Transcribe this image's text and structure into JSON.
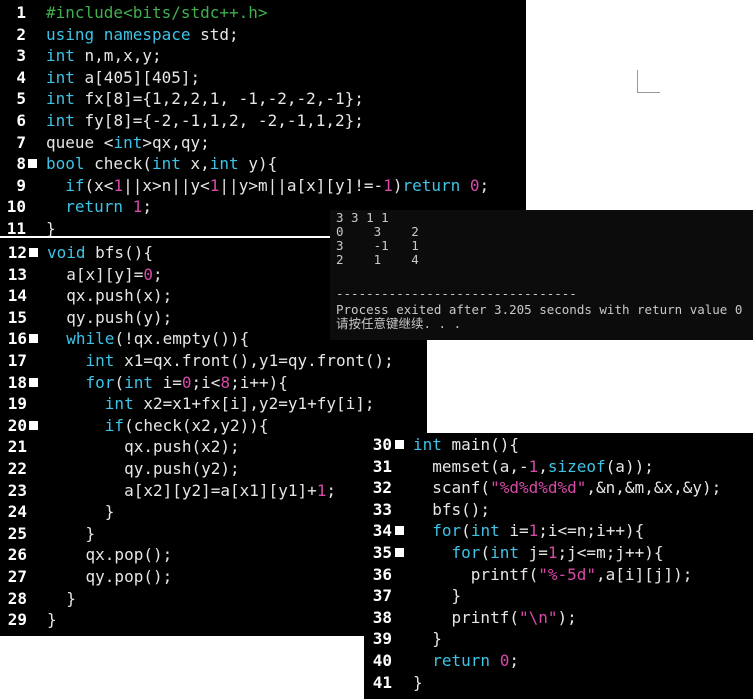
{
  "panel1": {
    "lines": [
      {
        "num": "1",
        "fold": false,
        "html": "<span class=\"pp\">#include&lt;bits/stdc++.h&gt;</span>"
      },
      {
        "num": "2",
        "fold": false,
        "html": "<span class=\"kw\">using namespace</span><span class=\"tx\"> std;</span>"
      },
      {
        "num": "3",
        "fold": false,
        "html": "<span class=\"kw\">int</span><span class=\"tx\"> n,m,x,y;</span>"
      },
      {
        "num": "4",
        "fold": false,
        "html": "<span class=\"kw\">int</span><span class=\"tx\"> a[405][405];</span>"
      },
      {
        "num": "5",
        "fold": false,
        "html": "<span class=\"kw\">int</span><span class=\"tx\"> fx[8]={1,2,2,1, -1,-2,-2,-1};</span>"
      },
      {
        "num": "6",
        "fold": false,
        "html": "<span class=\"kw\">int</span><span class=\"tx\"> fy[8]={-2,-1,1,2, -2,-1,1,2};</span>"
      },
      {
        "num": "7",
        "fold": false,
        "html": "<span class=\"tx\">queue &lt;</span><span class=\"kw\">int</span><span class=\"tx\">&gt;qx,qy;</span>"
      },
      {
        "num": "8",
        "fold": true,
        "html": "<span class=\"kw\">bool</span><span class=\"tx\"> check(</span><span class=\"kw\">int</span><span class=\"tx\"> x,</span><span class=\"kw\">int</span><span class=\"tx\"> y){</span>"
      },
      {
        "num": "9",
        "fold": false,
        "html": "<span class=\"tx\">  </span><span class=\"kw\">if</span><span class=\"tx\">(x&lt;</span><span class=\"nm\">1</span><span class=\"tx\">||x&gt;n||y&lt;</span><span class=\"nm\">1</span><span class=\"tx\">||y&gt;m||a[x][y]!=-</span><span class=\"nm\">1</span><span class=\"tx\">)</span><span class=\"kw\">return</span><span class=\"tx\"> </span><span class=\"nm\">0</span><span class=\"tx\">;</span>"
      },
      {
        "num": "10",
        "fold": false,
        "html": "<span class=\"tx\">  </span><span class=\"kw\">return</span><span class=\"tx\"> </span><span class=\"nm\">1</span><span class=\"tx\">;</span>"
      },
      {
        "num": "11",
        "fold": false,
        "html": "<span class=\"tx\">}</span>"
      }
    ]
  },
  "panel2": {
    "lines": [
      {
        "num": "12",
        "fold": true,
        "html": "<span class=\"kw\">void</span><span class=\"tx\"> bfs(){</span>"
      },
      {
        "num": "13",
        "fold": false,
        "html": "<span class=\"tx\">  a[x][y]=</span><span class=\"nm\">0</span><span class=\"tx\">;</span>"
      },
      {
        "num": "14",
        "fold": false,
        "html": "<span class=\"tx\">  qx.push(x);</span>"
      },
      {
        "num": "15",
        "fold": false,
        "html": "<span class=\"tx\">  qy.push(y);</span>"
      },
      {
        "num": "16",
        "fold": true,
        "html": "<span class=\"tx\">  </span><span class=\"kw\">while</span><span class=\"tx\">(!qx.empty()){</span>"
      },
      {
        "num": "17",
        "fold": false,
        "html": "<span class=\"tx\">    </span><span class=\"kw\">int</span><span class=\"tx\"> x1=qx.front(),y1=qy.front();</span>"
      },
      {
        "num": "18",
        "fold": true,
        "html": "<span class=\"tx\">    </span><span class=\"kw\">for</span><span class=\"tx\">(</span><span class=\"kw\">int</span><span class=\"tx\"> i=</span><span class=\"nm\">0</span><span class=\"tx\">;i&lt;</span><span class=\"nm\">8</span><span class=\"tx\">;i++){</span>"
      },
      {
        "num": "19",
        "fold": false,
        "html": "<span class=\"tx\">      </span><span class=\"kw\">int</span><span class=\"tx\"> x2=x1+fx[i],y2=y1+fy[i];</span>"
      },
      {
        "num": "20",
        "fold": true,
        "html": "<span class=\"tx\">      </span><span class=\"kw\">if</span><span class=\"tx\">(check(x2,y2)){</span>"
      },
      {
        "num": "21",
        "fold": false,
        "html": "<span class=\"tx\">        qx.push(x2);</span>"
      },
      {
        "num": "22",
        "fold": false,
        "html": "<span class=\"tx\">        qy.push(y2);</span>"
      },
      {
        "num": "23",
        "fold": false,
        "html": "<span class=\"tx\">        a[x2][y2]=a[x1][y1]+</span><span class=\"nm\">1</span><span class=\"tx\">;</span>"
      },
      {
        "num": "24",
        "fold": false,
        "html": "<span class=\"tx\">      }</span>"
      },
      {
        "num": "25",
        "fold": false,
        "html": "<span class=\"tx\">    }</span>"
      },
      {
        "num": "26",
        "fold": false,
        "html": "<span class=\"tx\">    qx.pop();</span>"
      },
      {
        "num": "27",
        "fold": false,
        "html": "<span class=\"tx\">    qy.pop();</span>"
      },
      {
        "num": "28",
        "fold": false,
        "html": "<span class=\"tx\">  }</span>"
      },
      {
        "num": "29",
        "fold": false,
        "html": "<span class=\"tx\">}</span>"
      }
    ]
  },
  "panel3": {
    "lines": [
      {
        "num": "30",
        "fold": true,
        "html": "<span class=\"kw\">int</span><span class=\"tx\"> main(){</span>"
      },
      {
        "num": "31",
        "fold": false,
        "html": "<span class=\"tx\">  memset(a,-</span><span class=\"nm\">1</span><span class=\"tx\">,</span><span class=\"kw\">sizeof</span><span class=\"tx\">(a));</span>"
      },
      {
        "num": "32",
        "fold": false,
        "html": "<span class=\"tx\">  scanf(</span><span class=\"st\">\"%d%d%d%d\"</span><span class=\"tx\">,&amp;n,&amp;m,&amp;x,&amp;y);</span>"
      },
      {
        "num": "33",
        "fold": false,
        "html": "<span class=\"tx\">  bfs();</span>"
      },
      {
        "num": "34",
        "fold": true,
        "html": "<span class=\"tx\">  </span><span class=\"kw\">for</span><span class=\"tx\">(</span><span class=\"kw\">int</span><span class=\"tx\"> i=</span><span class=\"nm\">1</span><span class=\"tx\">;i&lt;=n;i++){</span>"
      },
      {
        "num": "35",
        "fold": true,
        "html": "<span class=\"tx\">    </span><span class=\"kw\">for</span><span class=\"tx\">(</span><span class=\"kw\">int</span><span class=\"tx\"> j=</span><span class=\"nm\">1</span><span class=\"tx\">;j&lt;=m;j++){</span>"
      },
      {
        "num": "36",
        "fold": false,
        "html": "<span class=\"tx\">      printf(</span><span class=\"st\">\"%-5d\"</span><span class=\"tx\">,a[i][j]);</span>"
      },
      {
        "num": "37",
        "fold": false,
        "html": "<span class=\"tx\">    }</span>"
      },
      {
        "num": "38",
        "fold": false,
        "html": "<span class=\"tx\">    printf(</span><span class=\"st\">\"\\n\"</span><span class=\"tx\">);</span>"
      },
      {
        "num": "39",
        "fold": false,
        "html": "<span class=\"tx\">  }</span>"
      },
      {
        "num": "40",
        "fold": false,
        "html": "<span class=\"tx\">  </span><span class=\"kw\">return</span><span class=\"tx\"> </span><span class=\"nm\">0</span><span class=\"tx\">;</span>"
      },
      {
        "num": "41",
        "fold": false,
        "html": "<span class=\"tx\">}</span>"
      }
    ]
  },
  "console": {
    "lines": [
      "3 3 1 1",
      "0    3    2",
      "3    -1   1",
      "2    1    4",
      "",
      "--------------------------------",
      "Process exited after 3.205 seconds with return value 0",
      "请按任意键继续. . ."
    ]
  },
  "peek": [
    "(",
    "r",
    "<",
    "x"
  ],
  "colors": {
    "keyword": "#3ec3e6",
    "preprocessor": "#3fb04f",
    "number": "#d64aa8",
    "text": "#e6e6e6",
    "background": "#000000"
  }
}
